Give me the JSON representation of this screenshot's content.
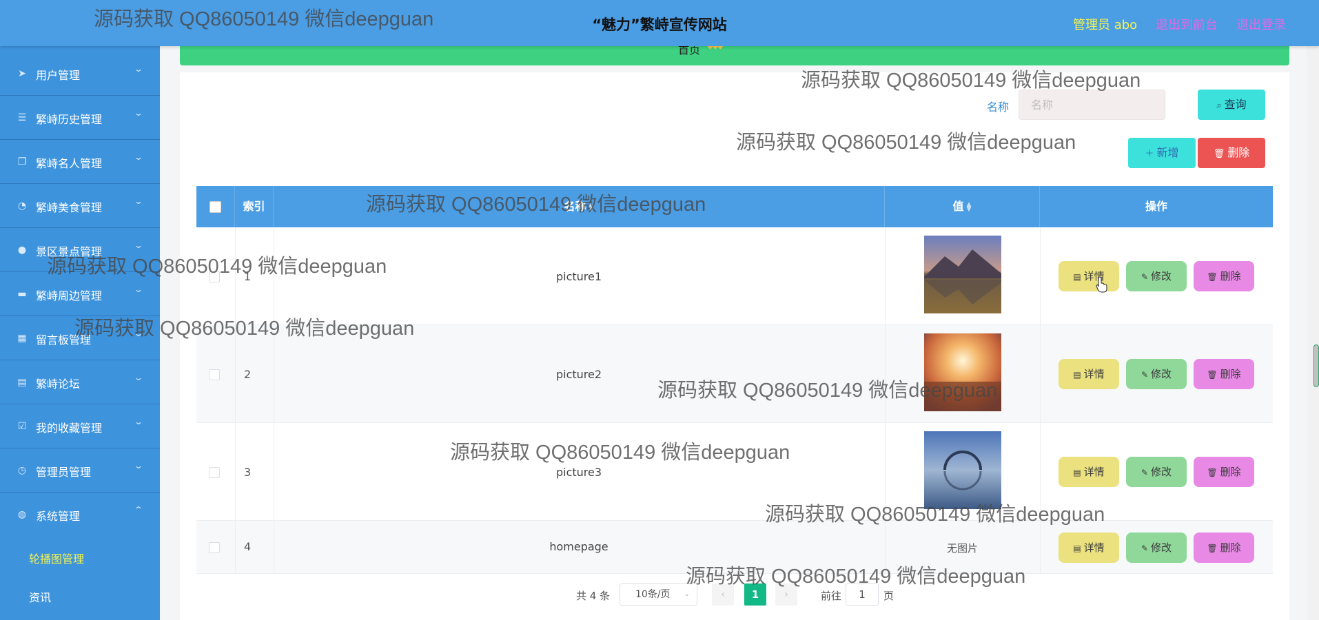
{
  "header": {
    "title": "“魅力”繁峙宣传网站",
    "admin": "管理员 abo",
    "to_front": "退出到前台",
    "logout": "退出登录"
  },
  "sidebar": {
    "items": [
      {
        "label": "用户管理",
        "icon": "send-icon"
      },
      {
        "label": "繁峙历史管理",
        "icon": "list-icon"
      },
      {
        "label": "繁峙名人管理",
        "icon": "copy-icon"
      },
      {
        "label": "繁峙美食管理",
        "icon": "dashboard-icon"
      },
      {
        "label": "景区景点管理",
        "icon": "user-icon"
      },
      {
        "label": "繁峙周边管理",
        "icon": "monitor-icon"
      },
      {
        "label": "留言板管理",
        "icon": "calendar-icon"
      },
      {
        "label": "繁峙论坛",
        "icon": "document-icon"
      },
      {
        "label": "我的收藏管理",
        "icon": "checkbox-icon"
      },
      {
        "label": "管理员管理",
        "icon": "clock-icon"
      },
      {
        "label": "系统管理",
        "icon": "globe-icon"
      }
    ],
    "sub_items": [
      {
        "label": "轮播图管理",
        "active": true
      },
      {
        "label": "资讯",
        "active": false
      }
    ]
  },
  "breadcrumb": {
    "home": "首页"
  },
  "search": {
    "label": "名称",
    "placeholder": "名称",
    "query_label": "查询",
    "add_label": "新增",
    "delete_label": "删除"
  },
  "table": {
    "columns": [
      "索引",
      "名称",
      "值",
      "操作"
    ],
    "rows": [
      {
        "index": "1",
        "name": "picture1",
        "value": "image"
      },
      {
        "index": "2",
        "name": "picture2",
        "value": "image"
      },
      {
        "index": "3",
        "name": "picture3",
        "value": "image"
      },
      {
        "index": "4",
        "name": "homepage",
        "value": "无图片"
      }
    ],
    "actions": {
      "detail": "详情",
      "edit": "修改",
      "delete": "删除"
    }
  },
  "pagination": {
    "total": "共 4 条",
    "page_size": "10条/页",
    "current_page": "1",
    "goto_label": "前往",
    "goto_value": "1",
    "page_unit": "页"
  },
  "watermark": "源码获取 QQ86050149 微信deepguan",
  "colors": {
    "header": "#4b9de4",
    "sidebar": "#3e93dd",
    "breadcrumb": "#3dd181",
    "table_header": "#4b9de4",
    "detail_btn": "#ebe17e",
    "edit_btn": "#8fd89a",
    "delete_btn": "#e989e6",
    "active_page": "#12b886"
  }
}
